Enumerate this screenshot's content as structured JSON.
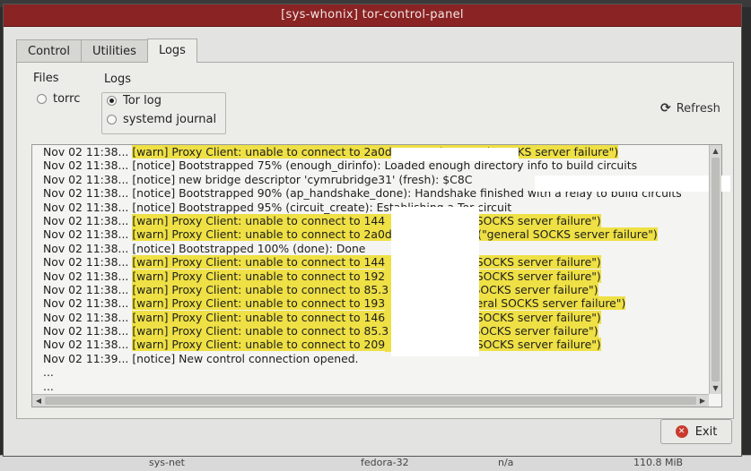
{
  "window": {
    "title": "[sys-whonix] tor-control-panel"
  },
  "tabs": [
    {
      "label": "Control",
      "active": false
    },
    {
      "label": "Utilities",
      "active": false
    },
    {
      "label": "Logs",
      "active": true
    }
  ],
  "files": {
    "label": "Files",
    "options": [
      {
        "label": "torrc",
        "selected": false
      }
    ]
  },
  "logs": {
    "label": "Logs",
    "options": [
      {
        "label": "Tor log",
        "selected": true
      },
      {
        "label": "systemd journal",
        "selected": false
      }
    ]
  },
  "refresh": {
    "label": "Refresh",
    "icon": "refresh-icon"
  },
  "exit": {
    "label": "Exit",
    "icon": "exit-icon"
  },
  "colors": {
    "titlebar": "#8a2323",
    "warn_highlight": "#eee045"
  },
  "log_lines": [
    {
      "time": "Nov 02 11:38...",
      "msg": "[warn] Proxy Client: unable to connect to 2a0d",
      "tail": "5 (\"general SOCKS server failure\")",
      "level": "warn"
    },
    {
      "time": "Nov 02 11:38...",
      "msg": "[notice] Bootstrapped 75% (enough_dirinfo): Loaded enough directory info to build circuits",
      "tail": "",
      "level": "notice"
    },
    {
      "time": "Nov 02 11:38...",
      "msg": "[notice] new bridge descriptor 'cymrubridge31' (fresh): $C8C",
      "tail": "",
      "level": "notice"
    },
    {
      "time": "Nov 02 11:38...",
      "msg": "[notice] Bootstrapped 90% (ap_handshake_done): Handshake finished with a relay to build circuits",
      "tail": "",
      "level": "notice"
    },
    {
      "time": "Nov 02 11:38...",
      "msg": "[notice] Bootstrapped 95% (circuit_create): Establishing a Tor circuit",
      "tail": "",
      "level": "notice"
    },
    {
      "time": "Nov 02 11:38...",
      "msg": "[warn] Proxy Client: unable to connect to 144",
      "tail": "(\"general SOCKS server failure\")",
      "level": "warn"
    },
    {
      "time": "Nov 02 11:38...",
      "msg": "[warn] Proxy Client: unable to connect to 2a0d",
      "tail": "1:27015 (\"general SOCKS server failure\")",
      "level": "warn"
    },
    {
      "time": "Nov 02 11:38...",
      "msg": "[notice] Bootstrapped 100% (done): Done",
      "tail": "",
      "level": "notice"
    },
    {
      "time": "Nov 02 11:38...",
      "msg": "[warn] Proxy Client: unable to connect to 144",
      "tail": "(\"general SOCKS server failure\")",
      "level": "warn"
    },
    {
      "time": "Nov 02 11:38...",
      "msg": "[warn] Proxy Client: unable to connect to 192",
      "tail": "(\"general SOCKS server failure\")",
      "level": "warn"
    },
    {
      "time": "Nov 02 11:38...",
      "msg": "[warn] Proxy Client: unable to connect to 85.3",
      "tail": "'general SOCKS server failure\")",
      "level": "warn"
    },
    {
      "time": "Nov 02 11:38...",
      "msg": "[warn] Proxy Client: unable to connect to 193",
      "tail": "025 (\"general SOCKS server failure\")",
      "level": "warn"
    },
    {
      "time": "Nov 02 11:38...",
      "msg": "[warn] Proxy Client: unable to connect to 146",
      "tail": "(\"general SOCKS server failure\")",
      "level": "warn"
    },
    {
      "time": "Nov 02 11:38...",
      "msg": "[warn] Proxy Client: unable to connect to 85.3",
      "tail": "'general SOCKS server failure\")",
      "level": "warn"
    },
    {
      "time": "Nov 02 11:38...",
      "msg": "[warn] Proxy Client: unable to connect to 209",
      "tail": "(\"general SOCKS server failure\")",
      "level": "warn"
    },
    {
      "time": "Nov 02 11:39...",
      "msg": "[notice] New control connection opened.",
      "tail": "",
      "level": "notice"
    },
    {
      "time": "...",
      "msg": "",
      "tail": "",
      "level": "notice"
    },
    {
      "time": "...",
      "msg": "",
      "tail": "",
      "level": "notice"
    }
  ],
  "taskbar": {
    "items": [
      "sys-net",
      "fedora-32",
      "n/a",
      "110.8 MiB"
    ]
  }
}
